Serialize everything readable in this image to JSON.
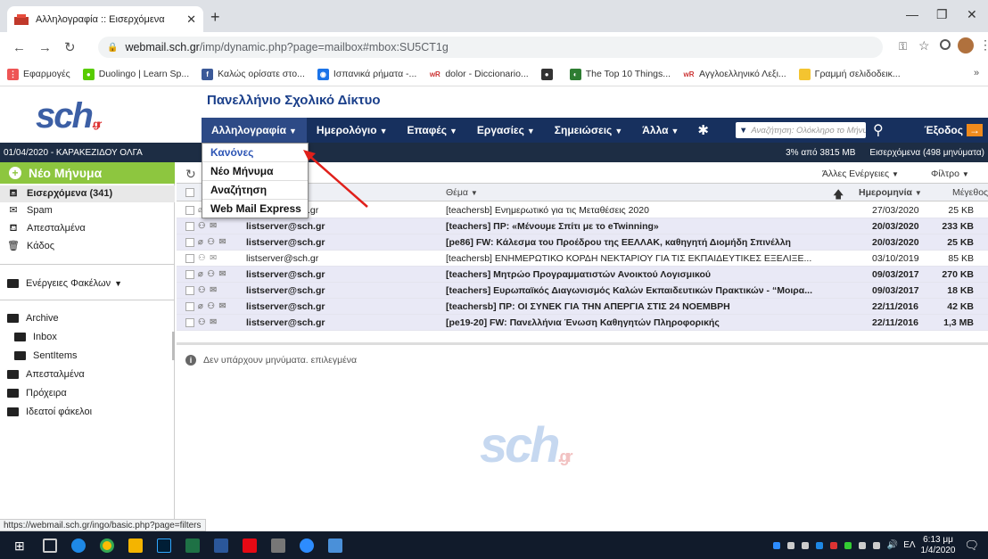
{
  "browser": {
    "tab_title": "Αλληλογραφία :: Εισερχόμενα",
    "new_tab": "+",
    "url_host": "webmail.sch.gr",
    "url_path": "/imp/dynamic.php?page=mailbox#mbox:SU5CT1g",
    "bookmarks": [
      "Εφαρμογές",
      "Duolingo | Learn Sp...",
      "Καλώς ορίσατε στο...",
      "Ισπανικά ρήματα -...",
      "dolor - Diccionario...",
      "The Top 10 Things...",
      "Αγγλοελληνικό Λεξι...",
      "Γραμμή σελιδοδεικ..."
    ],
    "bookmarks_more": "»",
    "link_status": "https://webmail.sch.gr/ingo/basic.php?page=filters"
  },
  "site": {
    "logo": "sch",
    "logo_suffix": ".gr",
    "title": "Πανελλήνιο Σχολικό Δίκτυο"
  },
  "menu": {
    "items": [
      "Αλληλογραφία",
      "Ημερολόγιο",
      "Επαφές",
      "Εργασίες",
      "Σημειώσεις",
      "Άλλα"
    ],
    "search_placeholder": "Αναζήτηση: Ολόκληρο το Μήνυμα",
    "logout": "Έξοδος"
  },
  "dropdown": {
    "items": [
      "Κανόνες",
      "Νέο Μήνυμα",
      "Αναζήτηση",
      "Web Mail Express"
    ]
  },
  "status": {
    "user": "01/04/2020 - ΚΑΡΑΚΕΖΙΔΟΥ ΟΛΓΑ",
    "quota": "3% από 3815 MB",
    "inbox_count": "Εισερχόμενα (498 μηνύματα)"
  },
  "sidebar": {
    "new_message": "Νέο Μήνυμα",
    "folders": [
      "Εισερχόμενα (341)",
      "Spam",
      "Απεσταλμένα",
      "Κάδος"
    ],
    "folder_actions": "Ενέργειες Φακέλων",
    "archive": "Archive",
    "archive_children": [
      "Inbox",
      "SentItems"
    ],
    "other_folders": [
      "Απεσταλμένα",
      "Πρόχειρα",
      "Ιδεατοί φάκελοι"
    ]
  },
  "list": {
    "other_actions": "Άλλες Ενέργειες",
    "filter": "Φίλτρο",
    "col_subject": "Θέμα",
    "col_date": "Ημερομηνία",
    "col_size": "Μέγεθος",
    "rows": [
      {
        "from": "listserver@sch.gr",
        "subject": "[teachersb] Ενημερωτικό για τις Μεταθέσεις 2020",
        "date": "27/03/2020",
        "size": "25 KB",
        "bold": false
      },
      {
        "from": "listserver@sch.gr",
        "subject": "[teachers] ΠΡ: «Μένουμε Σπίτι με το eTwinning»",
        "date": "20/03/2020",
        "size": "233 KB",
        "bold": true
      },
      {
        "from": "listserver@sch.gr",
        "subject": "[pe86] FW: Κάλεσμα του Προέδρου της ΕΕΛΛΑΚ, καθηγητή Διομήδη Σπινέλλη",
        "date": "20/03/2020",
        "size": "25 KB",
        "bold": true
      },
      {
        "from": "listserver@sch.gr",
        "subject": "[teachersb] ΕΝΗΜΕΡΩΤΙΚΟ ΚΟΡΔΗ ΝΕΚΤΑΡΙΟΥ ΓΙΑ ΤΙΣ ΕΚΠΑΙΔΕΥΤΙΚΕΣ ΕΞΕΛΙΞΕ...",
        "date": "03/10/2019",
        "size": "85 KB",
        "bold": false
      },
      {
        "from": "listserver@sch.gr",
        "subject": "[teachers] Μητρώο Προγραμματιστών Ανοικτού Λογισμικού",
        "date": "09/03/2017",
        "size": "270 KB",
        "bold": true
      },
      {
        "from": "listserver@sch.gr",
        "subject": "[teachers] Ευρωπαϊκός Διαγωνισμός Καλών Εκπαιδευτικών Πρακτικών - “Μοιρα...",
        "date": "09/03/2017",
        "size": "18 KB",
        "bold": true
      },
      {
        "from": "listserver@sch.gr",
        "subject": "[teachersb] ΠΡ: ΟΙ ΣΥΝΕΚ ΓΙΑ ΤΗΝ ΑΠΕΡΓΙΑ ΣΤΙΣ 24 ΝΟΕΜΒΡΗ",
        "date": "22/11/2016",
        "size": "42 KB",
        "bold": true
      },
      {
        "from": "listserver@sch.gr",
        "subject": "[pe19-20] FW: Πανελλήνια Ένωση Καθηγητών Πληροφορικής",
        "date": "22/11/2016",
        "size": "1,3 MB",
        "bold": true
      }
    ],
    "first_row_from_visible": "gr",
    "no_selection": "Δεν υπάρχουν μηνύματα. επιλεγμένα"
  },
  "taskbar": {
    "time": "6:13 μμ",
    "date": "1/4/2020",
    "lang": "ΕΛ"
  },
  "colors": {
    "menubar": "#17305e",
    "new_message": "#8dc63f",
    "status_bar": "#1d2d44",
    "row_shade": "#e9e9f6",
    "dropdown_highlight": "#2d55b5"
  }
}
